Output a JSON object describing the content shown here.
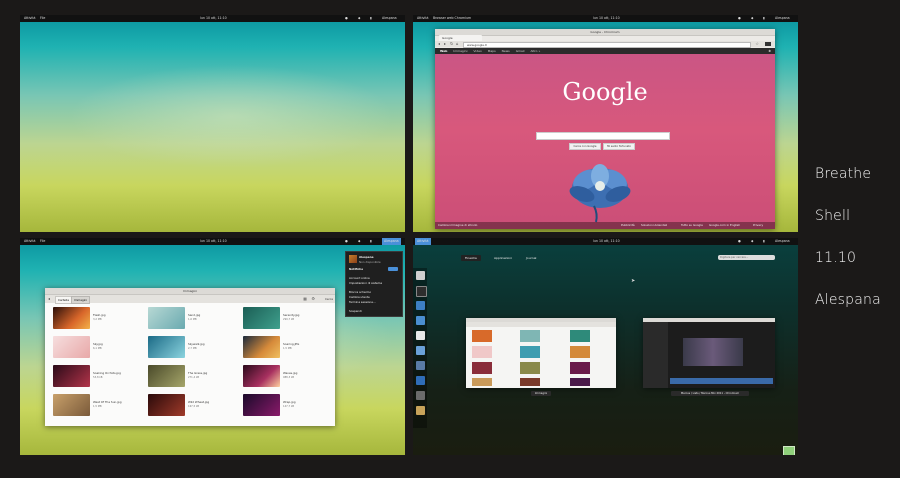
{
  "topbar": {
    "activities": "Attività",
    "clock": "lun 10 ott, 11:10",
    "user": "Alespana"
  },
  "app_menus": {
    "files": "File",
    "browser": "Browser web Chromium"
  },
  "side_titles": [
    "Breathe",
    "Shell",
    "11.10",
    "Alespana"
  ],
  "browser": {
    "window_title": "Google - Chromium",
    "tab_label": "Google",
    "url": "www.google.it",
    "nav_links": [
      "Web",
      "Immagini",
      "Video",
      "Maps",
      "News",
      "Gmail",
      "Altro »"
    ],
    "logo": "Google",
    "search_button": "Cerca con Google",
    "lucky_button": "Mi sento fortunato",
    "footer_left": "Cambia immagine di sfondo",
    "footer_links": [
      "Pubblicità",
      "Soluzioni Aziendali",
      "Tutto su Google",
      "Google.com in English",
      "Privacy"
    ]
  },
  "files_window": {
    "title": "Immagini",
    "crumbs": [
      "Cartella",
      "Immagini"
    ],
    "search_label": "Cerca",
    "files": [
      {
        "name": "Flash.jpg",
        "size": "3,2 MB"
      },
      {
        "name": "Sand.jpg",
        "size": "1,6 MB"
      },
      {
        "name": "Serenity.jpg",
        "size": "299,7 kB"
      },
      {
        "name": "Sky.jpg",
        "size": "6,1 MB"
      },
      {
        "name": "Skywalk.jpg",
        "size": "2,7 MB"
      },
      {
        "name": "Soaring.JPG",
        "size": "1,5 MB"
      },
      {
        "name": "Soaking Orchids.jpg",
        "size": "53,8 kB"
      },
      {
        "name": "The Grass.jpg",
        "size": "271,4 kB"
      },
      {
        "name": "Waves.jpg",
        "size": "988,3 kB"
      },
      {
        "name": "West Of The Sun.jpg",
        "size": "1,5 MB"
      },
      {
        "name": "Wild Wheat.jpg",
        "size": "167,5 kB"
      },
      {
        "name": "Wrap.jpg",
        "size": "147,7 kB"
      }
    ]
  },
  "user_menu": {
    "name": "Alespana",
    "status": "Non disponibile",
    "items": [
      "Notifiche",
      "Account online",
      "Impostazioni di sistema",
      "Blocca schermo",
      "Cambia utente",
      "Termina sessione...",
      "Sospendi"
    ]
  },
  "overview": {
    "tabs": [
      "Finestre",
      "Applicazioni",
      "Journal"
    ],
    "search_placeholder": "Digitare per cercare...",
    "captions": [
      "Immagini",
      "Marcus / Lists / Marcus Mix 2011 - Chromium"
    ]
  },
  "colors": {
    "accent": "#4a90d9",
    "google_pink": "#d8587c",
    "page_bg": "#1b1918"
  }
}
